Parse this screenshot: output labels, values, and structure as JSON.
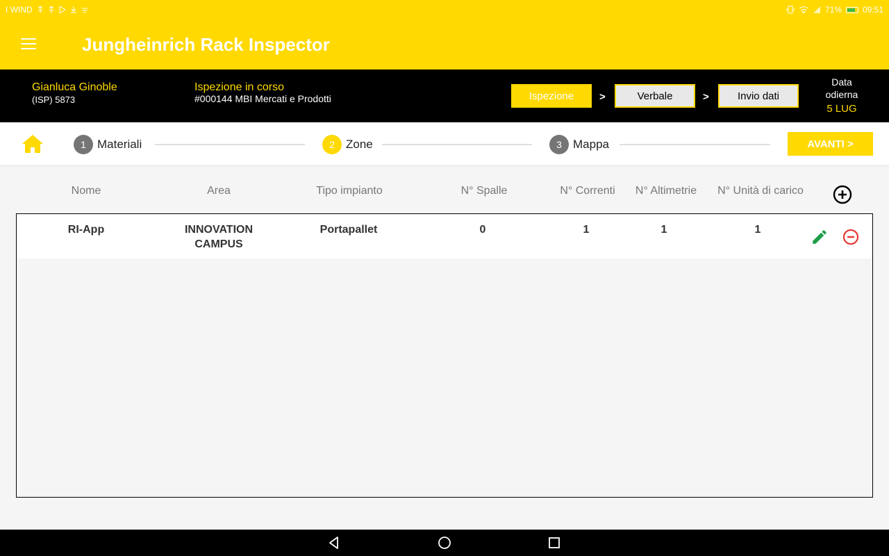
{
  "status_bar": {
    "carrier": "I WIND",
    "battery_percent": "71%",
    "time": "09:51"
  },
  "app_bar": {
    "title": "Jungheinrich Rack Inspector",
    "menu_icon": "menu-icon"
  },
  "info_bar": {
    "user_name": "Gianluca Ginoble",
    "user_id": "(ISP) 5873",
    "inspection_status": "Ispezione in corso",
    "inspection_code": "#000144 MBI Mercati e Prodotti",
    "steps": [
      {
        "label": "Ispezione",
        "active": true
      },
      {
        "label": "Verbale",
        "active": false
      },
      {
        "label": "Invio dati",
        "active": false
      }
    ],
    "arrow": ">",
    "date_label_line1": "Data",
    "date_label_line2": "odierna",
    "date_value": "5 LUG"
  },
  "stepper": {
    "home_icon": "home-icon",
    "steps": [
      {
        "number": "1",
        "label": "Materiali",
        "current": false
      },
      {
        "number": "2",
        "label": "Zone",
        "current": true
      },
      {
        "number": "3",
        "label": "Mappa",
        "current": false
      }
    ],
    "next_label": "AVANTI >"
  },
  "table": {
    "columns": [
      "Nome",
      "Area",
      "Tipo impianto",
      "N° Spalle",
      "N° Correnti",
      "N° Altimetrie",
      "N° Unità di carico"
    ],
    "rows": [
      {
        "nome": "RI-App",
        "area_line1": "INNOVATION",
        "area_line2": "CAMPUS",
        "tipo": "Portapallet",
        "spalle": "0",
        "correnti": "1",
        "altimetrie": "1",
        "unita": "1"
      }
    ]
  },
  "colors": {
    "accent": "#ffd900",
    "edit": "#1e9e4a",
    "remove": "#e53935"
  }
}
